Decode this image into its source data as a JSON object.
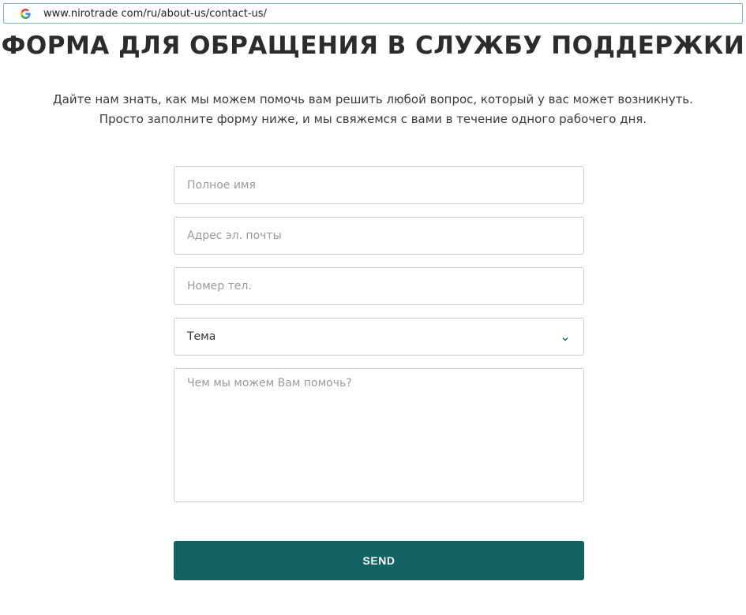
{
  "browser": {
    "url": "www.nirotrade com/ru/about-us/contact-us/",
    "favicon_icon": "google-g-icon"
  },
  "page": {
    "title": "ФОРМА ДЛЯ ОБРАЩЕНИЯ В СЛУЖБУ ПОДДЕРЖКИ",
    "subtitle_line1": "Дайте нам знать, как мы можем помочь вам решить любой вопрос, который у вас может возникнуть.",
    "subtitle_line2": "Просто заполните форму ниже, и мы свяжемся с вами в течение одного рабочего дня."
  },
  "form": {
    "name_placeholder": "Полное имя",
    "name_value": "",
    "email_placeholder": "Адрес эл. почты",
    "email_value": "",
    "phone_placeholder": "Номер тел.",
    "phone_value": "",
    "topic_selected": "Тема",
    "message_placeholder": "Чем мы можем Вам помочь?",
    "message_value": "",
    "submit_label": "SEND"
  },
  "colors": {
    "accent": "#126262",
    "url_border": "#7fb3d5",
    "chevron": "#126262"
  }
}
